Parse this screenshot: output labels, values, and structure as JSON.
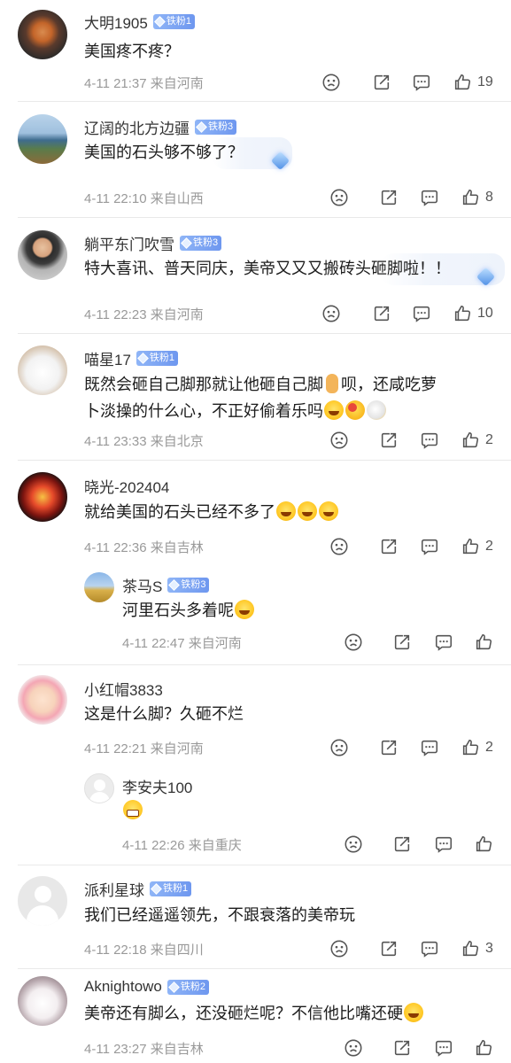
{
  "comments": [
    {
      "user": "大明1905",
      "badge": "铁粉1",
      "text": "美国疼不疼？",
      "meta": "4-11 21:37  来自河南",
      "likes": "19"
    },
    {
      "user": "辽阔的北方边疆",
      "badge": "铁粉3",
      "text": "美国的石头够不够了？",
      "meta": "4-11 22:10  来自山西",
      "likes": "8"
    },
    {
      "user": "躺平东门吹雪",
      "badge": "铁粉3",
      "text": "特大喜讯、普天同庆，美帝又又又搬砖头砸脚啦！！",
      "meta": "4-11 22:23  来自河南",
      "likes": "10"
    },
    {
      "user": "喵星17",
      "badge": "铁粉1",
      "text1": "既然会砸自己脚那就让他砸自己脚",
      "text1b": "呗，还咸吃萝",
      "text2": "卜淡操的什么心，不正好偷着乐吗",
      "meta": "4-11 23:33  来自北京",
      "likes": "2"
    },
    {
      "user": "晓光-202404",
      "text": "就给美国的石头已经不多了",
      "meta": "4-11 22:36  来自吉林",
      "likes": "2"
    },
    {
      "user": "茶马S",
      "badge": "铁粉3",
      "text": "河里石头多着呢",
      "meta": "4-11 22:47  来自河南",
      "likes": ""
    },
    {
      "user": "小红帽3833",
      "text": "这是什么脚？久砸不烂",
      "meta": "4-11 22:21  来自河南",
      "likes": "2"
    },
    {
      "user": "李安夫100",
      "text": "",
      "meta": "4-11 22:26  来自重庆",
      "likes": ""
    },
    {
      "user": "派利星球",
      "badge": "铁粉1",
      "text": "我们已经遥遥领先，不跟衰落的美帝玩",
      "meta": "4-11 22:18  来自四川",
      "likes": "3"
    },
    {
      "user": "Aknightowo",
      "badge": "铁粉2",
      "text": "美帝还有脚么，还没砸烂呢？不信他比嘴还硬",
      "meta": "4-11 23:27  来自吉林",
      "likes": ""
    }
  ],
  "icons": {
    "dislike": "sad-face-icon",
    "share": "share-icon",
    "reply": "comment-icon",
    "like": "thumbs-up-icon"
  },
  "colors": {
    "badge": "#7aa2f2",
    "meta": "#999999",
    "text": "#1c1c1c"
  }
}
